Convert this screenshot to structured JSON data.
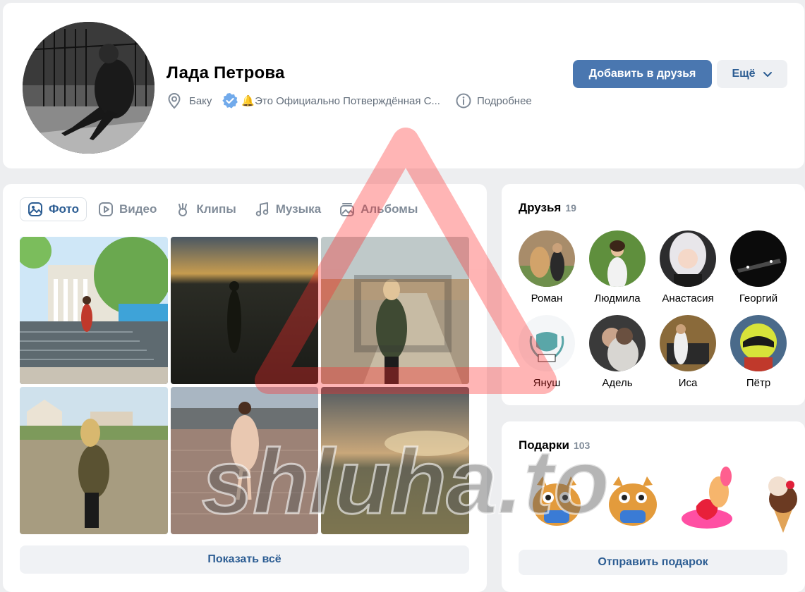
{
  "profile": {
    "name": "Лада Петрова",
    "city": "Баку",
    "status": "🔔Это Официально Потверждённая С...",
    "details_label": "Подробнее",
    "add_friend_label": "Добавить в друзья",
    "more_label": "Ещё"
  },
  "tabs": [
    {
      "label": "Фото",
      "active": true,
      "icon": "photo-icon"
    },
    {
      "label": "Видео",
      "active": false,
      "icon": "video-icon"
    },
    {
      "label": "Клипы",
      "active": false,
      "icon": "clips-icon"
    },
    {
      "label": "Музыка",
      "active": false,
      "icon": "music-icon"
    },
    {
      "label": "Альбомы",
      "active": false,
      "icon": "albums-icon"
    }
  ],
  "photos": {
    "show_all_label": "Показать всё"
  },
  "friends": {
    "title": "Друзья",
    "count": "19",
    "items": [
      {
        "name": "Роман"
      },
      {
        "name": "Людмила"
      },
      {
        "name": "Анастасия"
      },
      {
        "name": "Георгий"
      },
      {
        "name": "Януш"
      },
      {
        "name": "Адель"
      },
      {
        "name": "Иса"
      },
      {
        "name": "Пётр"
      }
    ]
  },
  "gifts": {
    "title": "Подарки",
    "count": "103",
    "send_label": "Отправить подарок"
  },
  "watermark": "shluha.to",
  "colors": {
    "accent": "#4a77b0",
    "link": "#2c5d93",
    "verified": "#71aaeb",
    "watermark_red": "#ff5a5a"
  }
}
